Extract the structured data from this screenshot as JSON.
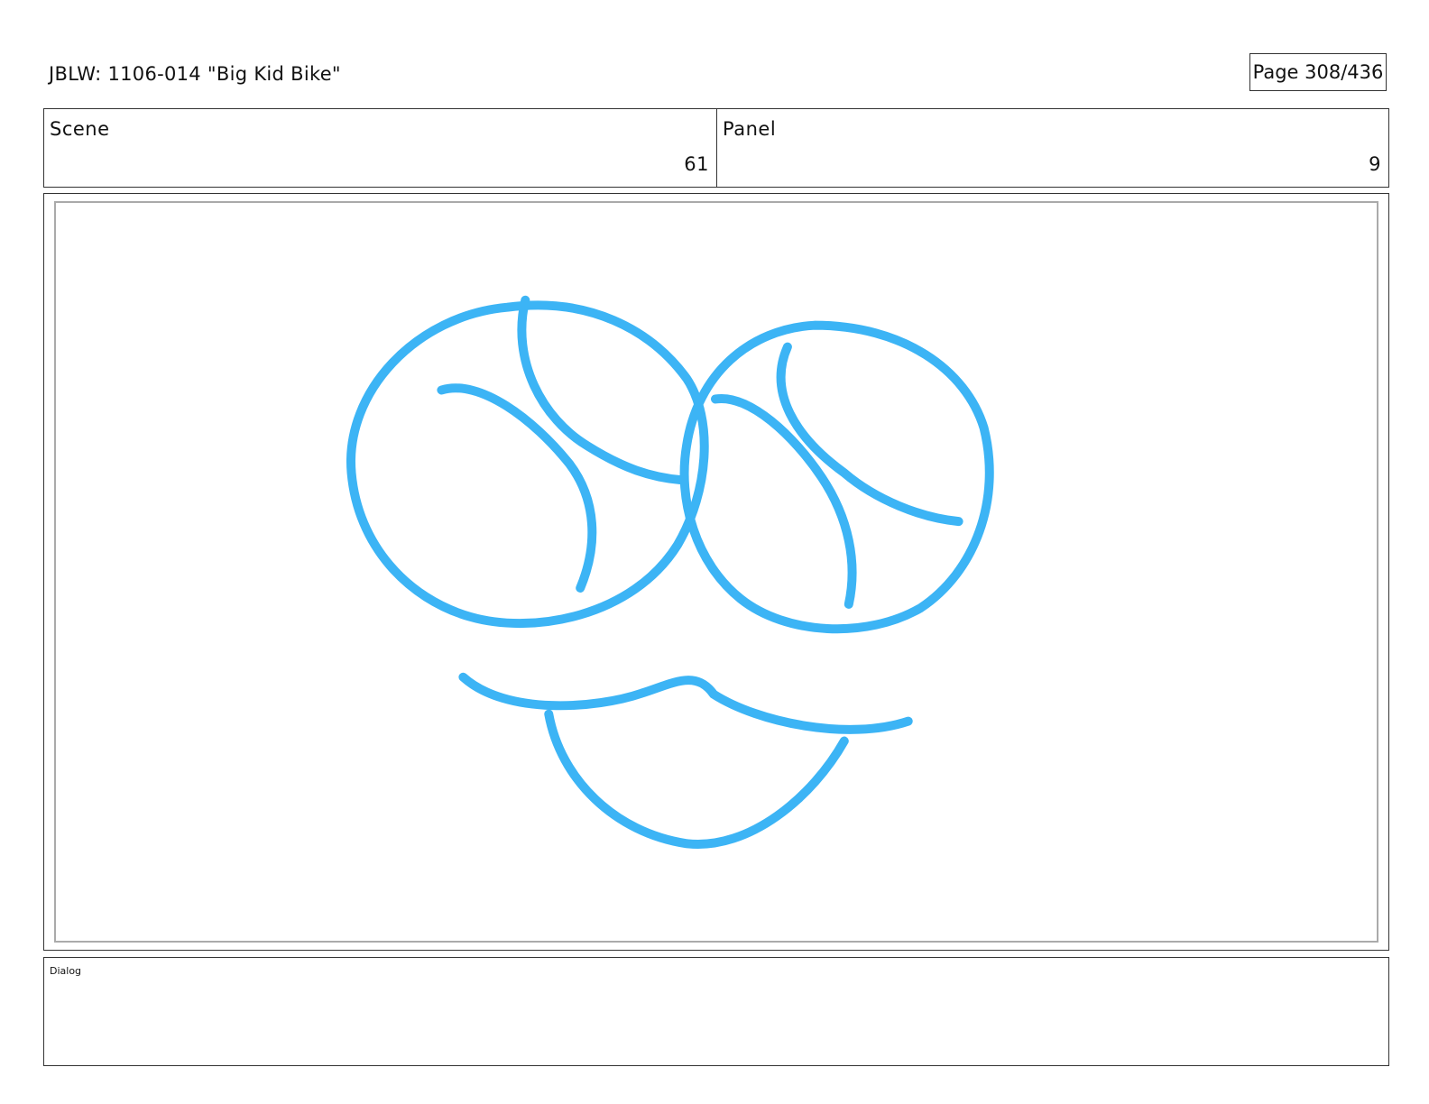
{
  "header": {
    "title": "JBLW: 1106-014 \"Big Kid Bike\"",
    "page_indicator": "Page 308/436"
  },
  "scene": {
    "label": "Scene",
    "value": "61"
  },
  "panel": {
    "label": "Panel",
    "value": "9"
  },
  "drawing": {
    "stroke_color": "#3cb4f5"
  },
  "dialog": {
    "label": "Dialog",
    "text": ""
  }
}
